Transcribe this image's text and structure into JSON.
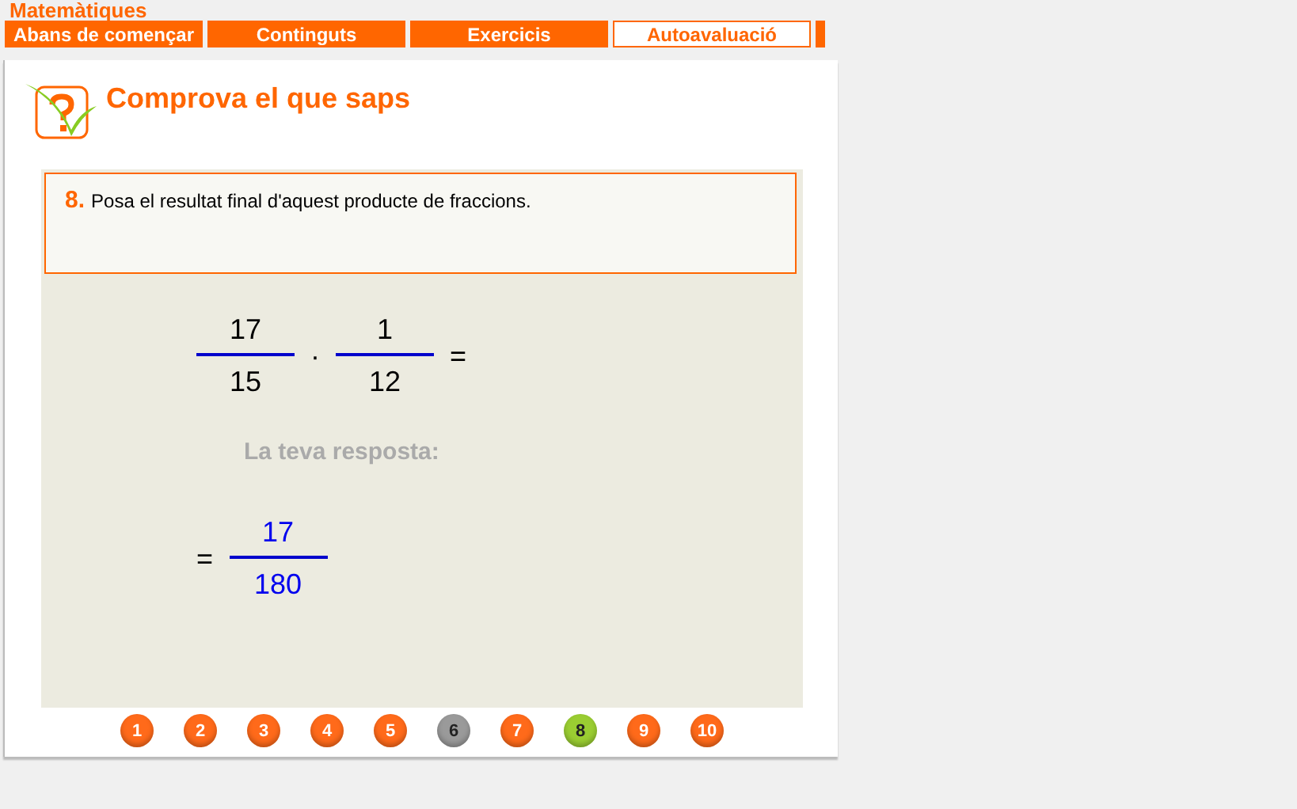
{
  "site_title": "Matemàtiques",
  "tabs": [
    {
      "label": "Abans de començar",
      "selected": false
    },
    {
      "label": "Continguts",
      "selected": false
    },
    {
      "label": "Exercicis",
      "selected": false
    },
    {
      "label": "Autoavaluació",
      "selected": true
    }
  ],
  "section_title": "Comprova el que saps",
  "question": {
    "number": "8.",
    "text": "Posa el resultat final d'aquest producte de fraccions."
  },
  "expression": {
    "fractions": [
      {
        "numerator": "17",
        "denominator": "15"
      },
      {
        "numerator": "1",
        "denominator": "12"
      }
    ],
    "operator": "·",
    "equals": "="
  },
  "answer_label": "La teva resposta:",
  "answer": {
    "equals": "=",
    "numerator": "17",
    "denominator": "180"
  },
  "pages": [
    {
      "label": "1",
      "visited": false,
      "selected": false
    },
    {
      "label": "2",
      "visited": false,
      "selected": false
    },
    {
      "label": "3",
      "visited": false,
      "selected": false
    },
    {
      "label": "4",
      "visited": false,
      "selected": false
    },
    {
      "label": "5",
      "visited": false,
      "selected": false
    },
    {
      "label": "6",
      "visited": true,
      "selected": false
    },
    {
      "label": "7",
      "visited": false,
      "selected": false
    },
    {
      "label": "8",
      "visited": false,
      "selected": true
    },
    {
      "label": "9",
      "visited": false,
      "selected": false
    },
    {
      "label": "10",
      "visited": false,
      "selected": false
    }
  ]
}
